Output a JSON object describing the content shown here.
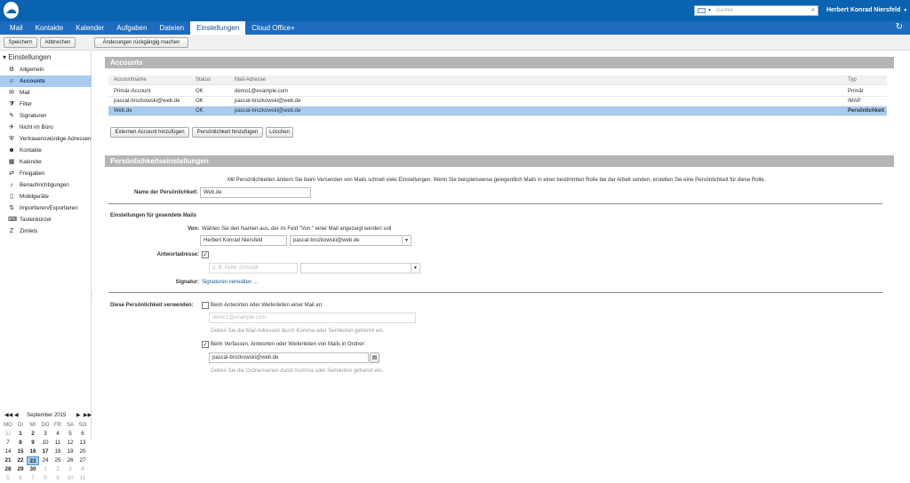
{
  "header": {
    "search_placeholder": "Suchen",
    "user_name": "Herbert Konrad Niersfeld"
  },
  "tabs": [
    "Mail",
    "Kontakte",
    "Kalender",
    "Aufgaben",
    "Dateien",
    "Einstellungen",
    "Cloud Office+"
  ],
  "active_tab": "Einstellungen",
  "toolbar": {
    "save": "Speichern",
    "cancel": "Abbrechen",
    "undo": "Änderungen rückgängig machen"
  },
  "sidebar": {
    "heading": "Einstellungen",
    "items": [
      {
        "label": "Allgemein",
        "icon": "gear-icon"
      },
      {
        "label": "Accounts",
        "icon": "accounts-icon"
      },
      {
        "label": "Mail",
        "icon": "mail-icon"
      },
      {
        "label": "Filter",
        "icon": "filter-icon"
      },
      {
        "label": "Signaturen",
        "icon": "signature-icon"
      },
      {
        "label": "Nicht im Büro",
        "icon": "out-of-office-icon"
      },
      {
        "label": "Vertrauenswürdige Adressen",
        "icon": "shield-icon"
      },
      {
        "label": "Kontakte",
        "icon": "contacts-icon"
      },
      {
        "label": "Kalender",
        "icon": "calendar-icon"
      },
      {
        "label": "Freigaben",
        "icon": "share-icon"
      },
      {
        "label": "Benachrichtigungen",
        "icon": "bell-icon"
      },
      {
        "label": "Mobilgeräte",
        "icon": "mobile-icon"
      },
      {
        "label": "Importieren/Exportieren",
        "icon": "import-export-icon"
      },
      {
        "label": "Tastenkürzel",
        "icon": "keyboard-icon"
      },
      {
        "label": "Zimlets",
        "icon": "zimlet-icon"
      }
    ],
    "selected": "Accounts"
  },
  "minical": {
    "month_label": "September 2015",
    "weekdays": [
      "MO",
      "DI",
      "MI",
      "DO",
      "FR",
      "SA",
      "SO"
    ],
    "weeks": [
      [
        "31",
        "1",
        "2",
        "3",
        "4",
        "5",
        "6"
      ],
      [
        "7",
        "8",
        "9",
        "10",
        "11",
        "12",
        "13"
      ],
      [
        "14",
        "15",
        "16",
        "17",
        "18",
        "19",
        "20"
      ],
      [
        "21",
        "22",
        "23",
        "24",
        "25",
        "26",
        "27"
      ],
      [
        "28",
        "29",
        "30",
        "1",
        "2",
        "3",
        "4"
      ],
      [
        "5",
        "6",
        "7",
        "8",
        "9",
        "10",
        "11"
      ]
    ],
    "today": "23",
    "bold_days": [
      "1",
      "2",
      "8",
      "9",
      "15",
      "16",
      "17",
      "21",
      "22",
      "23",
      "28",
      "29",
      "30"
    ]
  },
  "accounts_section": {
    "title": "Accounts",
    "columns": [
      "Accountname",
      "Status",
      "Mail-Adresse",
      "Typ"
    ],
    "rows": [
      {
        "name": "Primär-Account",
        "status": "OK",
        "email": "demo1@example.com",
        "type": "Primär"
      },
      {
        "name": "pascal-brozkowski@web.de",
        "status": "OK",
        "email": "pascal-brozkowski@web.de",
        "type": "IMAP"
      },
      {
        "name": "Web.de",
        "status": "OK",
        "email": "pascal-brozkowski@web.de",
        "type": "Persönlichkeit"
      }
    ],
    "selected_row": 2,
    "buttons": {
      "add_external": "Externen Account hinzufügen",
      "add_persona": "Persönlichkeit hinzufügen",
      "delete": "Löschen"
    }
  },
  "persona_section": {
    "title": "Persönlichkeitseinstellungen",
    "intro": "Mit Persönlichkeiten ändern Sie beim Versenden von Mails schnell viele Einstellungen. Wenn Sie beispielsweise gelegentlich Mails in einer bestimmten Rolle bei der Arbeit senden, erstellen Sie eine Persönlichkeit für diese Rolle.",
    "name_label": "Name der Persönlichkeit:",
    "name_value": "Web.de",
    "sent_heading": "Einstellungen für gesendete Mails",
    "from_label": "Von:",
    "from_hint": "Wählen Sie den Namen aus, der im Feld \"Von:\" einer Mail angezeigt werden soll",
    "from_name": "Herbert Konrad Niersfeld",
    "from_address": "pascal-brozkowski@web.de",
    "reply_label": "Antwortadresse:",
    "reply_checked": true,
    "reply_placeholder": "z. B. Peter Schmidt",
    "signature_label": "Signatur:",
    "signature_link": "Signaturen verwalten ...",
    "use_label": "Diese Persönlichkeit verwenden:",
    "use_reply_label": "Beim Antworten oder Weiterleiten einer Mail an:",
    "use_reply_checked": false,
    "use_reply_placeholder": "demo1@example.com",
    "use_reply_hint": "Geben Sie die Mail-Adressen durch Komma oder Semikolon getrennt ein.",
    "use_folder_label": "Beim Verfassen, Antworten oder Weiterleiten von Mails in Ordner:",
    "use_folder_checked": true,
    "use_folder_value": "pascal-brozkowski@web.de",
    "use_folder_hint": "Geben Sie die Ordnernamen durch Komma oder Semikolon getrennt ein."
  }
}
